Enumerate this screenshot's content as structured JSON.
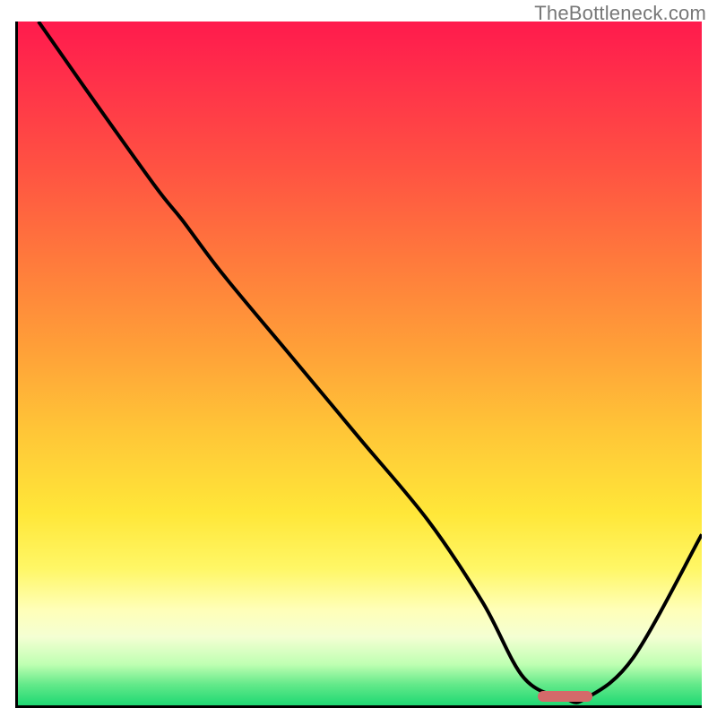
{
  "watermark": "TheBottleneck.com",
  "chart_data": {
    "type": "line",
    "title": "",
    "xlabel": "",
    "ylabel": "",
    "xlim": [
      0,
      100
    ],
    "ylim": [
      0,
      100
    ],
    "grid": false,
    "legend": false,
    "series": [
      {
        "name": "bottleneck-curve",
        "x": [
          3,
          10,
          20,
          24,
          30,
          40,
          50,
          60,
          68,
          74,
          80,
          83,
          90,
          100
        ],
        "y": [
          100,
          90,
          76,
          71,
          63,
          51,
          39,
          27,
          15,
          4,
          1,
          1,
          7,
          25
        ]
      }
    ],
    "annotations": [
      {
        "name": "optimal-marker",
        "shape": "pill",
        "x_start": 76,
        "x_end": 84,
        "y": 1,
        "color": "#d46a6a"
      }
    ],
    "background_gradient": {
      "direction": "vertical",
      "stops": [
        {
          "pos": 0.0,
          "color": "#ff1a4d"
        },
        {
          "pos": 0.35,
          "color": "#ff7a3c"
        },
        {
          "pos": 0.6,
          "color": "#ffc637"
        },
        {
          "pos": 0.8,
          "color": "#fff766"
        },
        {
          "pos": 0.9,
          "color": "#f4ffd3"
        },
        {
          "pos": 1.0,
          "color": "#1fd873"
        }
      ]
    }
  }
}
